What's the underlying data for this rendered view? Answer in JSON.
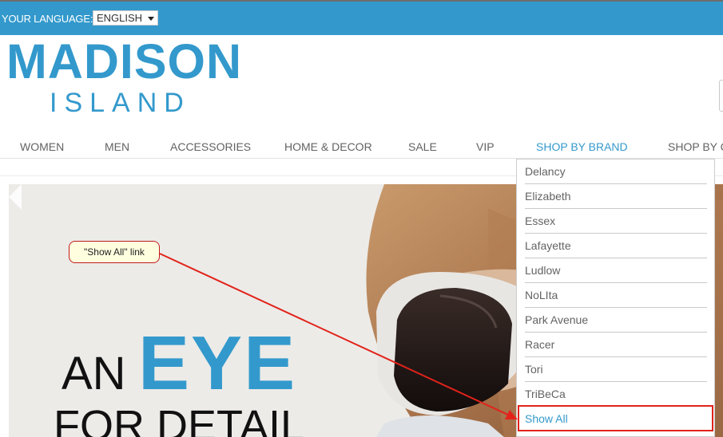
{
  "header": {
    "language_label": "YOUR LANGUAGE:",
    "language_value": "ENGLISH"
  },
  "logo": {
    "main": "MADISON",
    "sub": "ISLAND"
  },
  "nav": [
    {
      "label": "WOMEN"
    },
    {
      "label": "MEN"
    },
    {
      "label": "ACCESSORIES"
    },
    {
      "label": "HOME & DECOR"
    },
    {
      "label": "SALE"
    },
    {
      "label": "VIP"
    },
    {
      "label": "SHOP BY BRAND"
    },
    {
      "label": "SHOP BY C"
    }
  ],
  "hero": {
    "line1": "AN",
    "line1_accent": "EYE",
    "line2": "FOR DETAIL"
  },
  "brand_menu": [
    {
      "label": "Delancy"
    },
    {
      "label": "Elizabeth"
    },
    {
      "label": "Essex"
    },
    {
      "label": "Lafayette"
    },
    {
      "label": "Ludlow"
    },
    {
      "label": "NoLIta"
    },
    {
      "label": "Park Avenue"
    },
    {
      "label": "Racer"
    },
    {
      "label": "Tori"
    },
    {
      "label": "TriBeCa"
    },
    {
      "label": "Show All"
    }
  ],
  "annotation": {
    "callout": "\"Show All\" link"
  },
  "colors": {
    "brand": "#3399cc",
    "annotation_red": "#e2231a",
    "callout_bg": "#ffffe0"
  }
}
